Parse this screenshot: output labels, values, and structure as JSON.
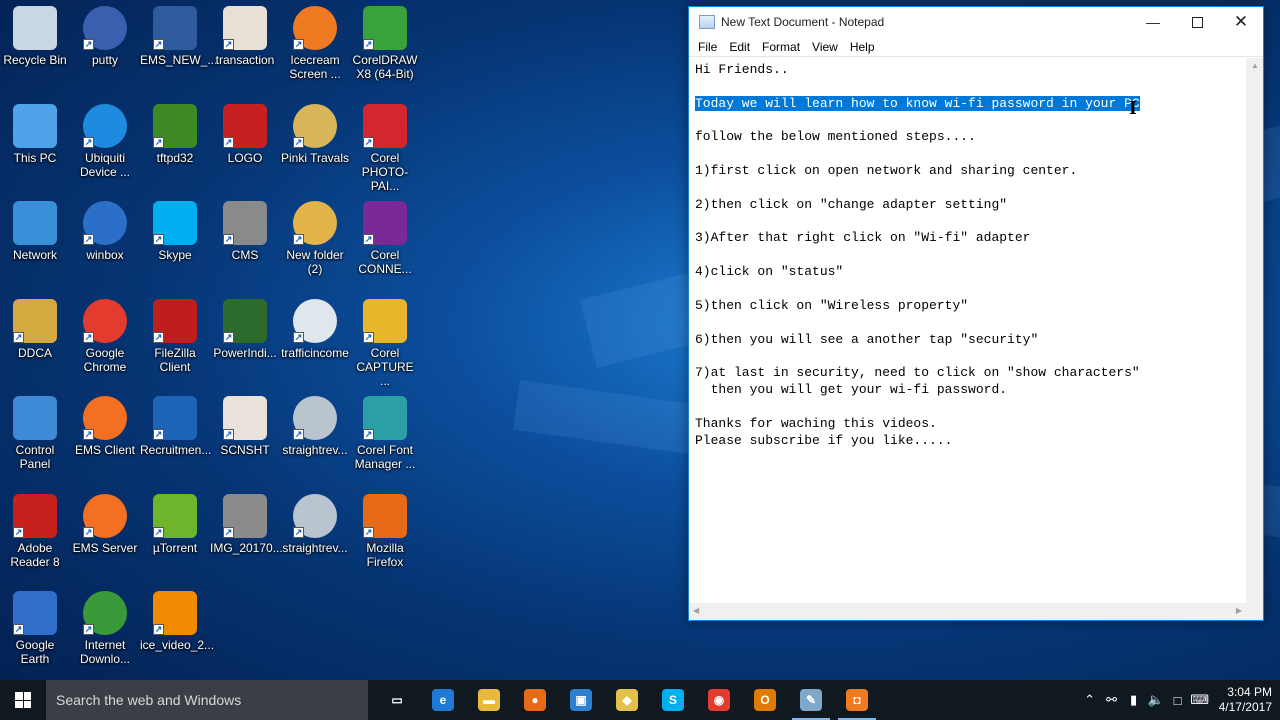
{
  "desktop": {
    "icons": [
      {
        "label": "Recycle Bin",
        "icon": "recycle-bin-icon",
        "color": "#c9d6e4"
      },
      {
        "label": "putty",
        "icon": "putty-icon",
        "color": "#3a5fae"
      },
      {
        "label": "EMS_NEW_...",
        "icon": "ems-new-icon",
        "color": "#2f5b9c"
      },
      {
        "label": "transaction",
        "icon": "transaction-icon",
        "color": "#e9e0d5"
      },
      {
        "label": "Icecream Screen ...",
        "icon": "icecream-icon",
        "color": "#f07a22"
      },
      {
        "label": "CorelDRAW X8 (64-Bit)",
        "icon": "coreldraw-icon",
        "color": "#3aa23c"
      },
      {
        "label": "This PC",
        "icon": "this-pc-icon",
        "color": "#4fa3e8"
      },
      {
        "label": "Ubiquiti Device ...",
        "icon": "ubiquiti-icon",
        "color": "#1f8be0"
      },
      {
        "label": "tftpd32",
        "icon": "tftpd-icon",
        "color": "#3d8a22"
      },
      {
        "label": "LOGO",
        "icon": "logo-icon",
        "color": "#c62020"
      },
      {
        "label": "Pinki Travals",
        "icon": "folder-icon",
        "color": "#d8b45a"
      },
      {
        "label": "Corel PHOTO-PAI...",
        "icon": "corel-photopaint-icon",
        "color": "#d4262e"
      },
      {
        "label": "Network",
        "icon": "network-icon",
        "color": "#3a90d8"
      },
      {
        "label": "winbox",
        "icon": "winbox-icon",
        "color": "#2b6fc8"
      },
      {
        "label": "Skype",
        "icon": "skype-icon",
        "color": "#00aff0"
      },
      {
        "label": "CMS",
        "icon": "cms-webcam-icon",
        "color": "#8a8a8a"
      },
      {
        "label": "New folder (2)",
        "icon": "folder-icon",
        "color": "#e3b44a"
      },
      {
        "label": "Corel CONNE...",
        "icon": "corel-connect-icon",
        "color": "#7a2a96"
      },
      {
        "label": "DDCA",
        "icon": "ddca-icon",
        "color": "#d4a940"
      },
      {
        "label": "Google Chrome",
        "icon": "chrome-icon",
        "color": "#e33b2e"
      },
      {
        "label": "FileZilla Client",
        "icon": "filezilla-icon",
        "color": "#bf1e1e"
      },
      {
        "label": "PowerIndi...",
        "icon": "powerindi-icon",
        "color": "#2d6b2d"
      },
      {
        "label": "trafficincome",
        "icon": "image-file-icon",
        "color": "#dfe6ee"
      },
      {
        "label": "Corel CAPTURE ...",
        "icon": "corel-capture-icon",
        "color": "#e8b62a"
      },
      {
        "label": "Control Panel",
        "icon": "control-panel-icon",
        "color": "#3e8ad6"
      },
      {
        "label": "EMS Client",
        "icon": "ems-client-icon",
        "color": "#f36f21"
      },
      {
        "label": "Recruitmen...",
        "icon": "pdf-icon",
        "color": "#1d63b6"
      },
      {
        "label": "SCNSHT",
        "icon": "image-file-icon",
        "color": "#e9e2da"
      },
      {
        "label": "straightrev...",
        "icon": "image-file-icon",
        "color": "#b9c4cf"
      },
      {
        "label": "Corel Font Manager ...",
        "icon": "corel-font-icon",
        "color": "#2aa0a6"
      },
      {
        "label": "Adobe Reader 8",
        "icon": "adobe-reader-icon",
        "color": "#c8201d"
      },
      {
        "label": "EMS Server",
        "icon": "ems-server-icon",
        "color": "#f36f21"
      },
      {
        "label": "µTorrent",
        "icon": "utorrent-icon",
        "color": "#6fb52c"
      },
      {
        "label": "IMG_20170...",
        "icon": "image-file-icon",
        "color": "#8b8b8b"
      },
      {
        "label": "straightrev...",
        "icon": "image-file-icon",
        "color": "#b9c4cf"
      },
      {
        "label": "Mozilla Firefox",
        "icon": "firefox-icon",
        "color": "#e66a17"
      },
      {
        "label": "Google Earth",
        "icon": "google-earth-icon",
        "color": "#2f6fc9"
      },
      {
        "label": "Internet Downlo...",
        "icon": "internet-download-manager-icon",
        "color": "#3a9a3a"
      },
      {
        "label": "ice_video_2...",
        "icon": "vlc-icon",
        "color": "#f08a00"
      }
    ]
  },
  "notepad": {
    "title": "New Text Document - Notepad",
    "menu": [
      "File",
      "Edit",
      "Format",
      "View",
      "Help"
    ],
    "lines": [
      "Hi Friends..",
      "",
      "Today we will learn how to know wi-fi password in your PC",
      "",
      "follow the below mentioned steps....",
      "",
      "1)first click on open network and sharing center.",
      "",
      "2)then click on \"change adapter setting\"",
      "",
      "3)After that right click on \"Wi-fi\" adapter",
      "",
      "4)click on \"status\"",
      "",
      "5)then click on \"Wireless property\"",
      "",
      "6)then you will see a another tap \"security\"",
      "",
      "7)at last in security, need to click on \"show characters\"",
      "  then you will get your wi-fi password.",
      "",
      "Thanks for waching this videos.",
      "Please subscribe if you like....."
    ],
    "selected_line_index": 2
  },
  "taskbar": {
    "search_placeholder": "Search the web and Windows",
    "apps": [
      {
        "name": "task-view-icon",
        "glyph": "▭",
        "color": "#101820"
      },
      {
        "name": "edge-icon",
        "glyph": "e",
        "color": "#1e7ad6"
      },
      {
        "name": "file-explorer-icon",
        "glyph": "▬",
        "color": "#e8b93a"
      },
      {
        "name": "firefox-icon",
        "glyph": "●",
        "color": "#e66a17"
      },
      {
        "name": "store-icon",
        "glyph": "▣",
        "color": "#2d7fd0"
      },
      {
        "name": "folder-icon",
        "glyph": "◆",
        "color": "#e3c04a"
      },
      {
        "name": "skype-icon",
        "glyph": "S",
        "color": "#00aff0"
      },
      {
        "name": "chrome-icon",
        "glyph": "◉",
        "color": "#e33b2e"
      },
      {
        "name": "outlook-icon",
        "glyph": "O",
        "color": "#e07b00"
      },
      {
        "name": "notepad-icon",
        "glyph": "✎",
        "color": "#7fa7c9"
      },
      {
        "name": "icecream-icon",
        "glyph": "◘",
        "color": "#f07a22"
      }
    ],
    "time": "3:04 PM",
    "date": "4/17/2017"
  }
}
